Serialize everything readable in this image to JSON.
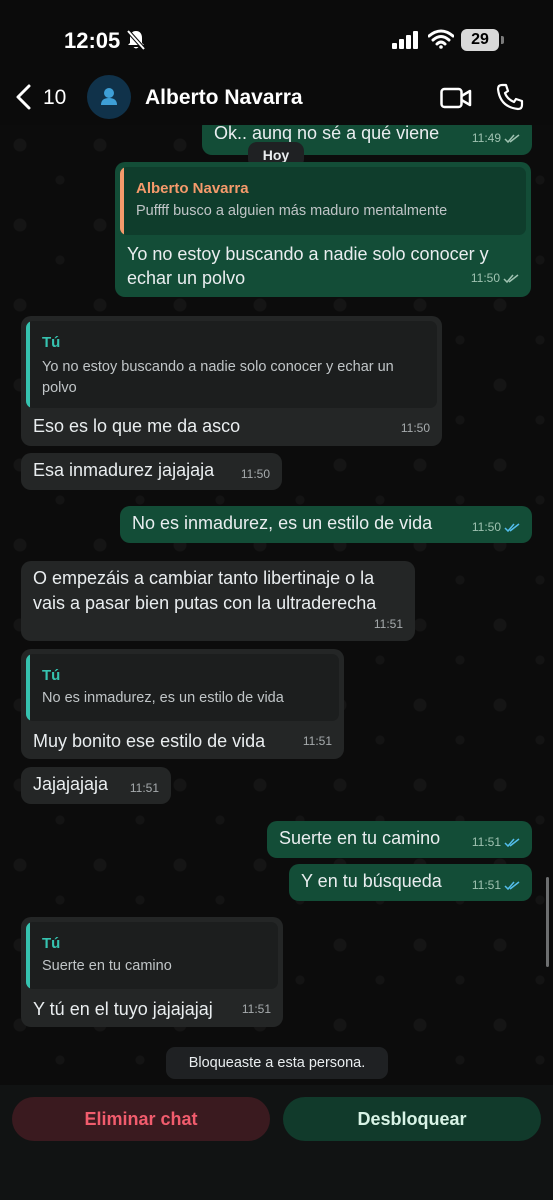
{
  "status_bar": {
    "time": "12:05",
    "battery": "29"
  },
  "header": {
    "back_count": "10",
    "contact_name": "Alberto Navarra"
  },
  "date_divider": "Hoy",
  "colors": {
    "outgoing": "#134d37",
    "incoming": "#242626",
    "read_ticks": "#53bdeb",
    "delete": "#f15c6d",
    "quote_self": "#36c3b0",
    "quote_contact": "#f59a6b"
  },
  "messages": [
    {
      "dir": "out",
      "text": "Ok.. aunq no sé a qué viene",
      "time": "11:49",
      "status": "delivered"
    },
    {
      "dir": "out",
      "quote_name": "Alberto Navarra",
      "quote_text": "Puffff busco a alguien más maduro mentalmente",
      "text_line1": "Yo no estoy buscando a nadie solo conocer y",
      "text_line2": "echar un polvo",
      "time": "11:50",
      "status": "delivered"
    },
    {
      "dir": "in",
      "quote_name": "Tú",
      "quote_line1": "Yo no estoy buscando a nadie solo conocer y echar un",
      "quote_line2": "polvo",
      "text": "Eso es lo que me da asco",
      "time": "11:50"
    },
    {
      "dir": "in",
      "text": "Esa inmadurez jajajaja",
      "time": "11:50"
    },
    {
      "dir": "out",
      "text": "No es inmadurez, es un estilo de vida",
      "time": "11:50",
      "status": "read"
    },
    {
      "dir": "in",
      "text_line1": "O empezáis a cambiar tanto libertinaje o la",
      "text_line2": "vais a pasar bien putas con la ultraderecha",
      "time": "11:51"
    },
    {
      "dir": "in",
      "quote_name": "Tú",
      "quote_text": "No es inmadurez, es un estilo de vida",
      "text": "Muy bonito ese estilo de vida",
      "time": "11:51"
    },
    {
      "dir": "in",
      "text": "Jajajajaja",
      "time": "11:51"
    },
    {
      "dir": "out",
      "text": "Suerte en tu camino",
      "time": "11:51",
      "status": "read"
    },
    {
      "dir": "out",
      "text": "Y en tu búsqueda",
      "time": "11:51",
      "status": "read"
    },
    {
      "dir": "in",
      "quote_name": "Tú",
      "quote_text": "Suerte en tu camino",
      "text": "Y tú en el tuyo jajajajaj",
      "time": "11:51"
    }
  ],
  "system_message": "Bloqueaste a esta persona.",
  "actions": {
    "delete_label": "Eliminar chat",
    "unblock_label": "Desbloquear"
  }
}
